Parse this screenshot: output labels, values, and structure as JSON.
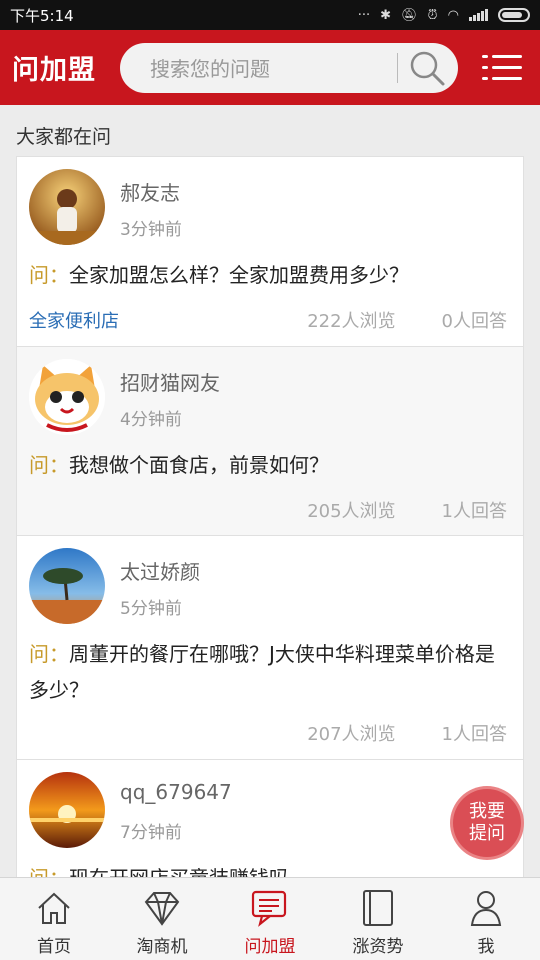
{
  "status_bar": {
    "time": "下午5:14",
    "colors": {
      "bg": "#111111",
      "fg": "#ffffff"
    }
  },
  "header": {
    "logo": "问加盟",
    "search_placeholder": "搜索您的问题",
    "icons": [
      "search-icon",
      "menu-icon"
    ],
    "colors": {
      "brand": "#c8161e"
    }
  },
  "section_title": "大家都在问",
  "questions": [
    {
      "user": "郝友志",
      "time": "3分钟前",
      "q_prefix": "问：",
      "text": "全家加盟怎么样？全家加盟费用多少？",
      "tag": "全家便利店",
      "views": "222人浏览",
      "answers": "0人回答"
    },
    {
      "user": "招财猫网友",
      "time": "4分钟前",
      "q_prefix": "问：",
      "text": "我想做个面食店，前景如何？",
      "views": "205人浏览",
      "answers": "1人回答"
    },
    {
      "user": "太过娇颜",
      "time": "5分钟前",
      "q_prefix": "问：",
      "text": "周董开的餐厅在哪哦？J大侠中华料理菜单价格是多少？",
      "views": "207人浏览",
      "answers": "1人回答"
    },
    {
      "user": "qq_679647",
      "time": "7分钟前",
      "q_prefix": "问：",
      "text": "现在开网店买童装赚钱吗"
    }
  ],
  "ask_button": {
    "line1": "我要",
    "line2": "提问"
  },
  "bottom_nav": [
    {
      "label": "首页",
      "icon": "home-icon"
    },
    {
      "label": "淘商机",
      "icon": "diamond-icon"
    },
    {
      "label": "问加盟",
      "icon": "chat-icon",
      "active": true
    },
    {
      "label": "涨资势",
      "icon": "book-icon"
    },
    {
      "label": "我",
      "icon": "user-icon"
    }
  ]
}
